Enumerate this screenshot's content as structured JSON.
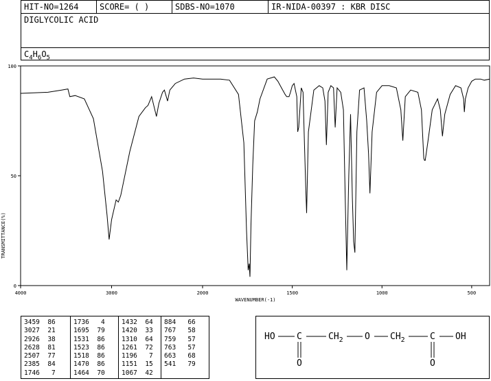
{
  "header": {
    "hit_no": "HIT-NO=1264",
    "score": "SCORE=  (  )",
    "sdbs_no": "SDBS-NO=1070",
    "method": "IR-NIDA-00397 : KBR DISC",
    "compound_name": "DIGLYCOLIC ACID",
    "formula": {
      "c": "C",
      "c_n": "4",
      "h": "H",
      "h_n": "6",
      "o": "O",
      "o_n": "5"
    }
  },
  "chart_data": {
    "type": "line",
    "xlabel": "WAVENUMBER(-1)",
    "ylabel": "TRANSMITTANCE(%)",
    "xlim": [
      4000,
      400
    ],
    "ylim": [
      0,
      100
    ],
    "x_ticks": [
      "4000",
      "3000",
      "2000",
      "1500",
      "1000",
      "500"
    ],
    "y_ticks": [
      "100",
      "50",
      "0"
    ],
    "series": [
      {
        "x": [
          4000,
          3700,
          3550,
          3480,
          3459,
          3400,
          3300,
          3200,
          3100,
          3050,
          3027,
          3000,
          2950,
          2926,
          2900,
          2800,
          2700,
          2628,
          2600,
          2560,
          2507,
          2480,
          2440,
          2420,
          2385,
          2360,
          2300,
          2200,
          2100,
          2000,
          1900,
          1850,
          1800,
          1770,
          1755,
          1746,
          1740,
          1736,
          1730,
          1720,
          1710,
          1695,
          1680,
          1640,
          1600,
          1580,
          1560,
          1540,
          1531,
          1525,
          1523,
          1519,
          1518,
          1510,
          1500,
          1490,
          1475,
          1470,
          1464,
          1450,
          1440,
          1432,
          1425,
          1420,
          1410,
          1380,
          1350,
          1330,
          1318,
          1310,
          1300,
          1285,
          1270,
          1261,
          1250,
          1230,
          1215,
          1205,
          1196,
          1185,
          1175,
          1165,
          1158,
          1151,
          1140,
          1125,
          1100,
          1085,
          1075,
          1067,
          1055,
          1030,
          1000,
          960,
          920,
          895,
          884,
          870,
          840,
          800,
          780,
          767,
          763,
          759,
          745,
          720,
          690,
          675,
          663,
          650,
          620,
          590,
          560,
          545,
          541,
          535,
          520,
          500,
          480,
          450,
          430,
          400
        ],
        "y": [
          87.5,
          88,
          89,
          89.5,
          86,
          86.5,
          85,
          76,
          52,
          32,
          21,
          30,
          39,
          38,
          41,
          61,
          77,
          81,
          82,
          86,
          77,
          83,
          88,
          89,
          84,
          89,
          92,
          94,
          94.5,
          94,
          94,
          93.5,
          87,
          65,
          25,
          7,
          10,
          4,
          28,
          55,
          75,
          79,
          85,
          94,
          95,
          93,
          90,
          87,
          86,
          86,
          86,
          86,
          86,
          88,
          91,
          92,
          86,
          70,
          72,
          90,
          88,
          64,
          45,
          33,
          70,
          89,
          91,
          90,
          84,
          64,
          88,
          91,
          90,
          72,
          90,
          88,
          80,
          40,
          7,
          50,
          78,
          40,
          20,
          15,
          70,
          89,
          90,
          75,
          60,
          42,
          70,
          88,
          91,
          91,
          90,
          80,
          66,
          86,
          89,
          88,
          80,
          58,
          57,
          57,
          65,
          80,
          85,
          80,
          68,
          78,
          87,
          91,
          90,
          85,
          79,
          85,
          90,
          93,
          94,
          94,
          93.5,
          94
        ]
      }
    ]
  },
  "peak_table": [
    [
      [
        "3459",
        "86"
      ],
      [
        "3027",
        "21"
      ],
      [
        "2926",
        "38"
      ],
      [
        "2628",
        "81"
      ],
      [
        "2507",
        "77"
      ],
      [
        "2385",
        "84"
      ],
      [
        "1746",
        "7"
      ]
    ],
    [
      [
        "1736",
        "4"
      ],
      [
        "1695",
        "79"
      ],
      [
        "1531",
        "86"
      ],
      [
        "1523",
        "86"
      ],
      [
        "1518",
        "86"
      ],
      [
        "1470",
        "86"
      ],
      [
        "1464",
        "70"
      ]
    ],
    [
      [
        "1432",
        "64"
      ],
      [
        "1420",
        "33"
      ],
      [
        "1310",
        "64"
      ],
      [
        "1261",
        "72"
      ],
      [
        "1196",
        "7"
      ],
      [
        "1151",
        "15"
      ],
      [
        "1067",
        "42"
      ]
    ],
    [
      [
        "884",
        "66"
      ],
      [
        "767",
        "58"
      ],
      [
        "759",
        "57"
      ],
      [
        "763",
        "57"
      ],
      [
        "663",
        "68"
      ],
      [
        "541",
        "79"
      ]
    ]
  ],
  "structure": {
    "labels": [
      "HO",
      "C",
      "CH",
      "2",
      "O",
      "CH",
      "2",
      "C",
      "OH"
    ],
    "carbonyl_o": "O"
  }
}
